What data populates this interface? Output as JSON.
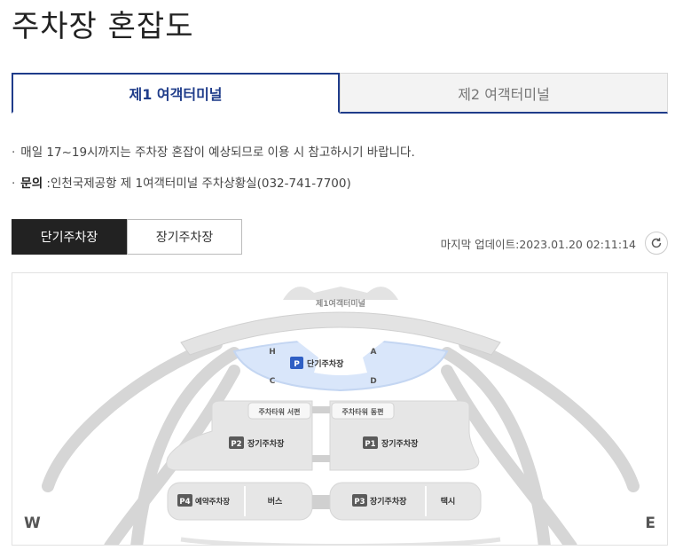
{
  "page": {
    "title": "주차장 혼잡도"
  },
  "terminal_tabs": [
    {
      "label": "제1 여객터미널",
      "active": true
    },
    {
      "label": "제2 여객터미널",
      "active": false
    }
  ],
  "notices": {
    "congestion": "매일 17~19시까지는 주차장 혼잡이 예상되므로 이용 시 참고하시기 바랍니다.",
    "contact_label": "문의",
    "contact_text": " :인천국제공항 제 1여객터미널 주차상황실(032-741-7700)"
  },
  "lot_tabs": [
    {
      "label": "단기주차장",
      "active": true
    },
    {
      "label": "장기주차장",
      "active": false
    }
  ],
  "update": {
    "label": "마지막 업데이트:",
    "timestamp": "2023.01.20 02:11:14"
  },
  "map": {
    "terminal_label": "제1여객터미널",
    "short_term": {
      "badge": "P",
      "label": "단기주차장",
      "zones": [
        "H",
        "A",
        "C",
        "D"
      ]
    },
    "tower_west": "주차타워 서편",
    "tower_east": "주차타워 동편",
    "p2": {
      "badge": "P2",
      "label": "장기주차장"
    },
    "p1": {
      "badge": "P1",
      "label": "장기주차장"
    },
    "p4": {
      "badge": "P4",
      "label": "예약주차장"
    },
    "bus": "버스",
    "p3": {
      "badge": "P3",
      "label": "장기주차장"
    },
    "taxi": "택시",
    "compass_w": "W",
    "compass_e": "E"
  },
  "colors": {
    "accent": "#1f3c8a",
    "badge_blue": "#2f5fc4",
    "badge_gray": "#5a5a5a"
  }
}
